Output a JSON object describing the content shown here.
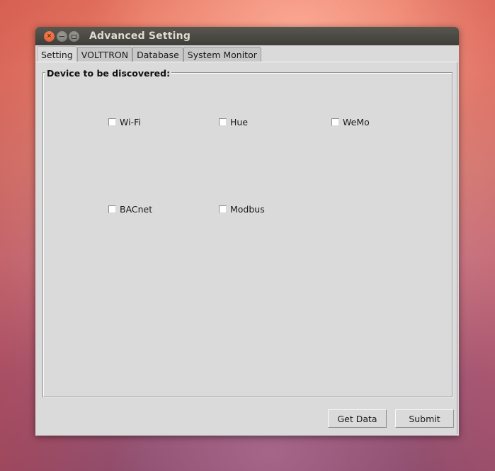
{
  "window": {
    "title": "Advanced Setting",
    "controls": [
      "close",
      "minimize",
      "maximize"
    ]
  },
  "tabs": [
    {
      "label": "Setting",
      "active": true
    },
    {
      "label": "VOLTTRON",
      "active": false
    },
    {
      "label": "Database",
      "active": false
    },
    {
      "label": "System Monitor",
      "active": false
    }
  ],
  "group": {
    "title": "Device to be discovered:",
    "checkboxes": [
      {
        "label": "Wi-Fi",
        "checked": false
      },
      {
        "label": "Hue",
        "checked": false
      },
      {
        "label": "WeMo",
        "checked": false
      },
      {
        "label": "BACnet",
        "checked": false
      },
      {
        "label": "Modbus",
        "checked": false
      }
    ]
  },
  "buttons": {
    "get_data": "Get Data",
    "submit": "Submit"
  }
}
